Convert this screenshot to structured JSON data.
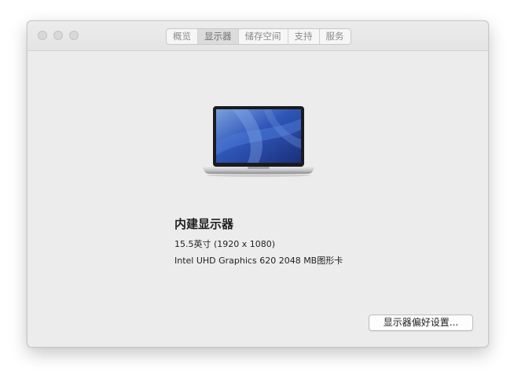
{
  "tabs": [
    {
      "label": "概览",
      "active": false
    },
    {
      "label": "显示器",
      "active": true
    },
    {
      "label": "储存空间",
      "active": false
    },
    {
      "label": "支持",
      "active": false
    },
    {
      "label": "服务",
      "active": false
    }
  ],
  "display": {
    "name": "内建显示器",
    "size_resolution": "15.5英寸 (1920 x 1080)",
    "graphics": "Intel UHD Graphics 620 2048 MB图形卡"
  },
  "buttons": {
    "display_prefs": "显示器偏好设置..."
  },
  "icons": {
    "hero": "laptop-icon"
  }
}
